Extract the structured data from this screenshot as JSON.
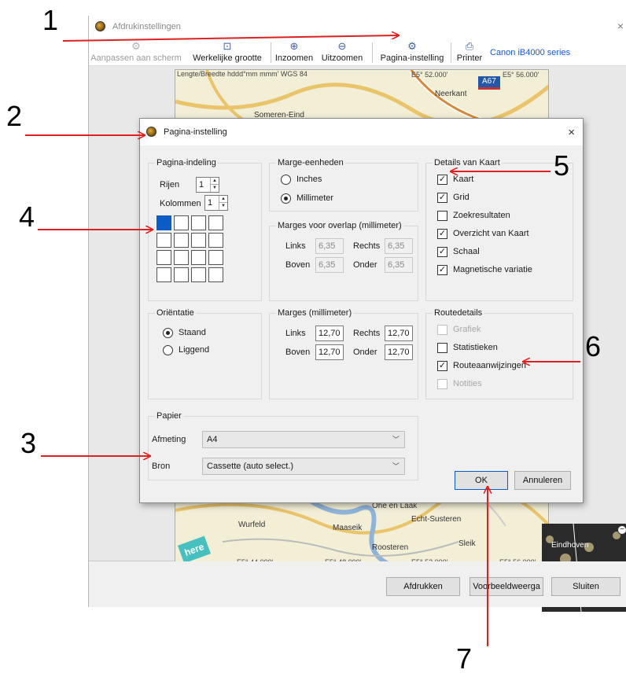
{
  "print_window": {
    "title": "Afdrukinstellingen",
    "close": "×",
    "toolbar": [
      {
        "label": "Aanpassen aan scherm",
        "icon": "fit-icon",
        "glyph": "⚙",
        "disabled": true
      },
      {
        "label": "Werkelijke grootte",
        "icon": "actual-size-icon",
        "glyph": "⊡",
        "disabled": false
      },
      {
        "label": "Inzoomen",
        "icon": "zoom-in-icon",
        "glyph": "⊕",
        "disabled": false
      },
      {
        "label": "Uitzoomen",
        "icon": "zoom-out-icon",
        "glyph": "⊖",
        "disabled": false
      },
      {
        "label": "Pagina-instelling",
        "icon": "page-setup-icon",
        "glyph": "⚙",
        "disabled": false
      },
      {
        "label": "Printer",
        "icon": "printer-icon",
        "glyph": "⎙",
        "disabled": false
      }
    ],
    "printer_name": "Canon iB4000 series",
    "map": {
      "header": "Lengte/Breedte hddd°mm mmm' WGS 84",
      "top_coord_1": "E5° 52.000'",
      "top_coord_2": "E5° 56.000'",
      "road_label": "A67",
      "places": [
        "Neerkant",
        "Someren-Eind",
        "Ohé en Laak",
        "Echt-Susteren",
        "Wurfeld",
        "Maaseik",
        "Roosteren",
        "Sleik"
      ],
      "bottom_coords": [
        "E5° 44.000'",
        "E5° 48.000'",
        "E5° 52.000'",
        "E5° 56.000'"
      ],
      "logo": "here"
    },
    "minimap_label": "Eindhoven",
    "buttons": {
      "print": "Afdrukken",
      "preview": "Voorbeeldweerga",
      "close": "Sluiten"
    }
  },
  "dialog": {
    "title": "Pagina-instelling",
    "close": "×",
    "layout": {
      "title": "Pagina-indeling",
      "rows_label": "Rijen",
      "rows_value": "1",
      "cols_label": "Kolommen",
      "cols_value": "1"
    },
    "margin_units": {
      "title": "Marge-eenheden",
      "options": [
        "Inches",
        "Millimeter"
      ],
      "selected": "Millimeter"
    },
    "overlap": {
      "title": "Marges voor overlap (millimeter)",
      "left_label": "Links",
      "left": "6,35",
      "right_label": "Rechts",
      "right": "6,35",
      "top_label": "Boven",
      "top": "6,35",
      "bottom_label": "Onder",
      "bottom": "6,35"
    },
    "map_details": {
      "title": "Details van Kaart",
      "items": [
        {
          "label": "Kaart",
          "checked": true
        },
        {
          "label": "Grid",
          "checked": true
        },
        {
          "label": "Zoekresultaten",
          "checked": false
        },
        {
          "label": "Overzicht van Kaart",
          "checked": true
        },
        {
          "label": "Schaal",
          "checked": true
        },
        {
          "label": "Magnetische variatie",
          "checked": true
        }
      ]
    },
    "orientation": {
      "title": "Oriëntatie",
      "options": [
        "Staand",
        "Liggend"
      ],
      "selected": "Staand"
    },
    "margins": {
      "title": "Marges (millimeter)",
      "left_label": "Links",
      "left": "12,70",
      "right_label": "Rechts",
      "right": "12,70",
      "top_label": "Boven",
      "top": "12,70",
      "bottom_label": "Onder",
      "bottom": "12,70"
    },
    "route_details": {
      "title": "Routedetails",
      "items": [
        {
          "label": "Grafiek",
          "checked": false,
          "disabled": true
        },
        {
          "label": "Statistieken",
          "checked": false,
          "disabled": false
        },
        {
          "label": "Routeaanwijzingen",
          "checked": true,
          "disabled": false
        },
        {
          "label": "Notities",
          "checked": false,
          "disabled": true
        }
      ]
    },
    "paper": {
      "title": "Papier",
      "size_label": "Afmeting",
      "size_value": "A4",
      "source_label": "Bron",
      "source_value": "Cassette (auto select.)"
    },
    "ok": "OK",
    "cancel": "Annuleren"
  },
  "annotations": [
    "1",
    "2",
    "3",
    "4",
    "5",
    "6",
    "7"
  ],
  "colors": {
    "arrow": "#e02020",
    "selected_cell": "#0b5cc4",
    "printer_link": "#1a56c8"
  }
}
